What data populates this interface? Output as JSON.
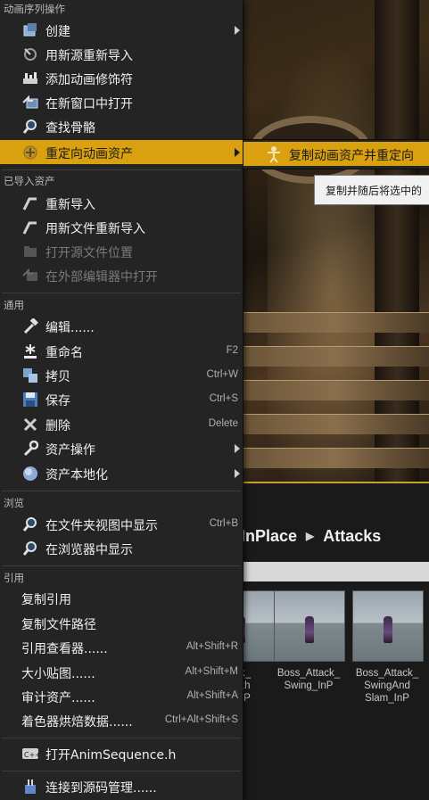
{
  "breadcrumb": {
    "items": [
      "InPlace",
      "Attacks"
    ]
  },
  "assets": [
    {
      "name": "ack_\nWith\n_InP",
      "label_lines": [
        "ack_",
        "With",
        "_InP"
      ]
    },
    {
      "name": "Boss_Attack_\nSwing_InP",
      "label_lines": [
        "Boss_Attack_",
        "Swing_InP"
      ]
    },
    {
      "name": "Boss_Attack_\nSwingAnd\nSlam_InP",
      "label_lines": [
        "Boss_Attack_",
        "SwingAnd",
        "Slam_InP"
      ]
    }
  ],
  "menu": {
    "sections": {
      "anim_sequence": "动画序列操作",
      "imported_asset": "已导入资产",
      "common": "通用",
      "browse": "浏览",
      "references": "引用"
    },
    "items": {
      "create": "创建",
      "reimport_new_source": "用新源重新导入",
      "add_anim_modifier": "添加动画修饰符",
      "open_new_window": "在新窗口中打开",
      "find_skeleton": "查找骨骼",
      "retarget_anim_assets": "重定向动画资产",
      "reimport": "重新导入",
      "reimport_new_file": "用新文件重新导入",
      "open_source_location": "打开源文件位置",
      "open_external_editor": "在外部编辑器中打开",
      "edit": "编辑......",
      "rename": "重命名",
      "copy": "拷贝",
      "save": "保存",
      "delete": "删除",
      "asset_actions": "资产操作",
      "asset_localization": "资产本地化",
      "show_in_folder_view": "在文件夹视图中显示",
      "show_in_explorer": "在浏览器中显示",
      "copy_reference": "复制引用",
      "copy_file_path": "复制文件路径",
      "reference_viewer": "引用查看器......",
      "size_map": "大小贴图......",
      "audit_assets": "审计资产......",
      "shader_cook_stats": "着色器烘焙数据......",
      "open_header": "打开AnimSequence.h",
      "connect_source_control": "连接到源码管理......"
    },
    "shortcuts": {
      "rename": "F2",
      "copy": "Ctrl+W",
      "save": "Ctrl+S",
      "delete": "Delete",
      "show_in_folder_view": "Ctrl+B",
      "reference_viewer": "Alt+Shift+R",
      "size_map": "Alt+Shift+M",
      "audit_assets": "Alt+Shift+A",
      "shader_cook_stats": "Ctrl+Alt+Shift+S"
    }
  },
  "submenu": {
    "duplicate_and_retarget": "复制动画资产并重定向"
  },
  "tooltip": {
    "text": "复制并随后将选中的"
  },
  "colors": {
    "highlight": "#d9a00f",
    "menu_bg": "#242424",
    "viewport_border": "#c8a030"
  }
}
